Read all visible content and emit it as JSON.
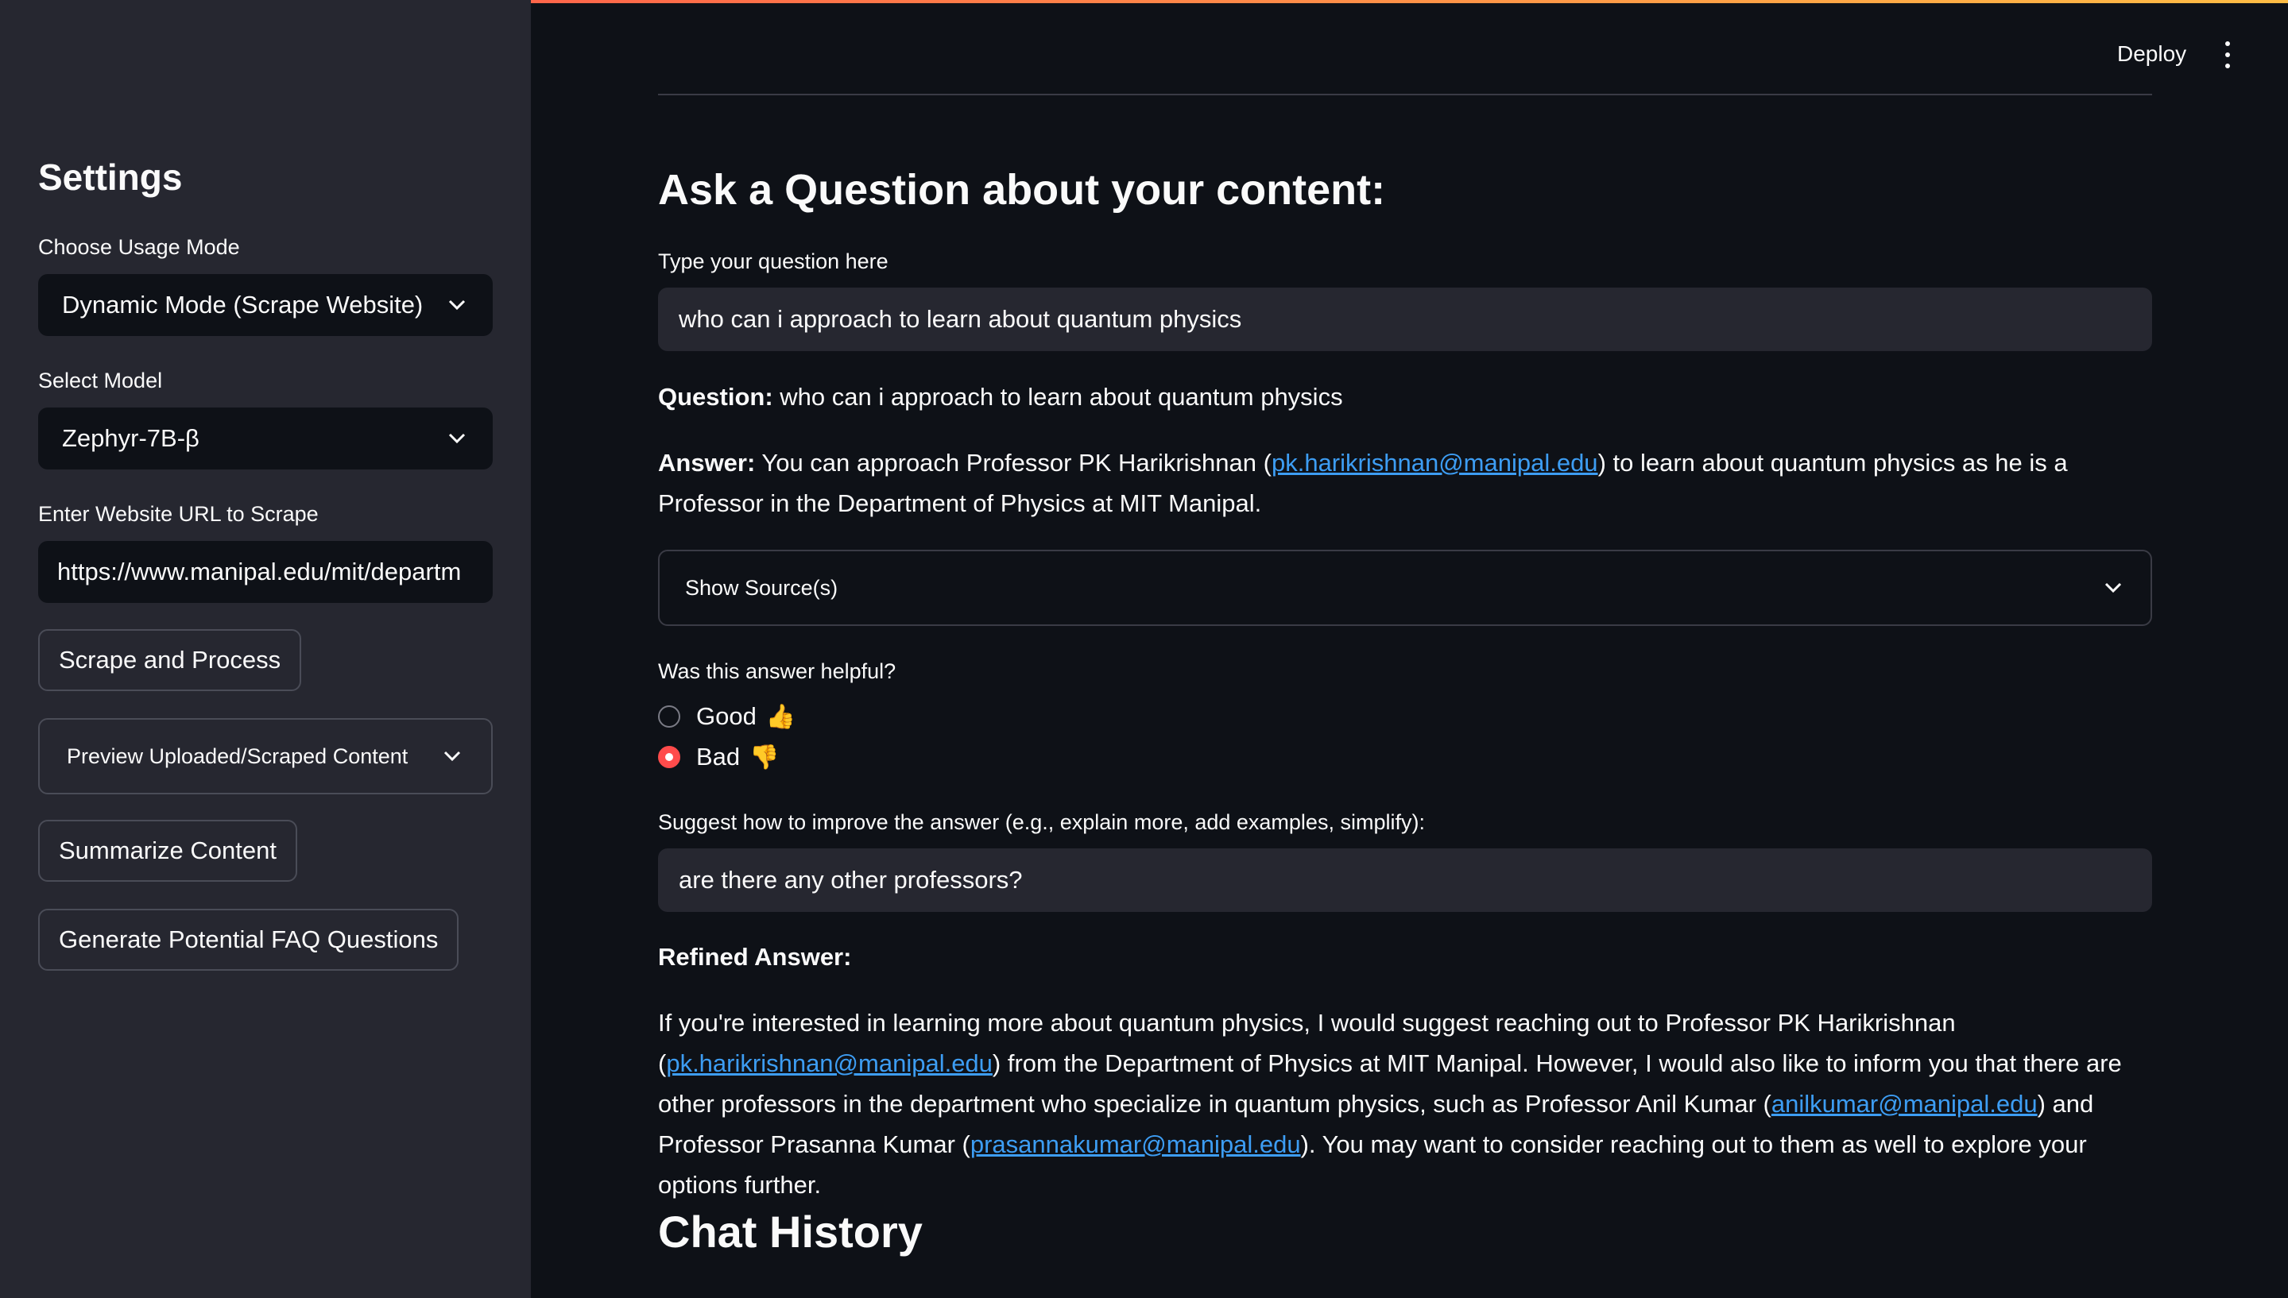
{
  "sidebar": {
    "title": "Settings",
    "usage_mode_label": "Choose Usage Mode",
    "usage_mode_value": "Dynamic Mode (Scrape Website)",
    "model_label": "Select Model",
    "model_value": "Zephyr-7B-β",
    "url_label": "Enter Website URL to Scrape",
    "url_value": "https://www.manipal.edu/mit/departm",
    "scrape_button": "Scrape and Process",
    "preview_expander": "Preview Uploaded/Scraped Content",
    "summarize_button": "Summarize Content",
    "faq_button": "Generate Potential FAQ Questions"
  },
  "header": {
    "deploy_label": "Deploy",
    "menu_icon": "vertical-dots-icon"
  },
  "main": {
    "title": "Ask a Question about your content:",
    "question_label": "Type your question here",
    "question_value": "who can i approach to learn about quantum physics",
    "question_prefix": "Question:",
    "question_text": "who can i approach to learn about quantum physics",
    "answer_prefix": "Answer:",
    "answer_part1": "You can approach Professor PK Harikrishnan (",
    "answer_link": "pk.harikrishnan@manipal.edu",
    "answer_part2": ") to learn about quantum physics as he is a Professor in the Department of Physics at MIT Manipal.",
    "sources_expander": "Show Source(s)",
    "feedback_label": "Was this answer helpful?",
    "feedback_options": [
      {
        "label": "Good",
        "emoji": "👍",
        "selected": false
      },
      {
        "label": "Bad",
        "emoji": "👎",
        "selected": true
      }
    ],
    "improve_label": "Suggest how to improve the answer (e.g., explain more, add examples, simplify):",
    "improve_value": "are there any other professors?",
    "refined_heading": "Refined Answer:",
    "refined": {
      "t1": "If you're interested in learning more about quantum physics, I would suggest reaching out to Professor PK Harikrishnan (",
      "link1": "pk.harikrishnan@manipal.edu",
      "t2": ") from the Department of Physics at MIT Manipal. However, I would also like to inform you that there are other professors in the department who specialize in quantum physics, such as Professor Anil Kumar (",
      "link2": "anilkumar@manipal.edu",
      "t3": ") and Professor Prasanna Kumar (",
      "link3": "prasannakumar@manipal.edu",
      "t4": "). You may want to consider reaching out to them as well to explore your options further."
    },
    "chat_history_heading": "Chat History"
  },
  "colors": {
    "accent": "#ff4b4b",
    "link": "#3d9df3",
    "sidebar_bg": "#262730",
    "main_bg": "#0e1117"
  }
}
